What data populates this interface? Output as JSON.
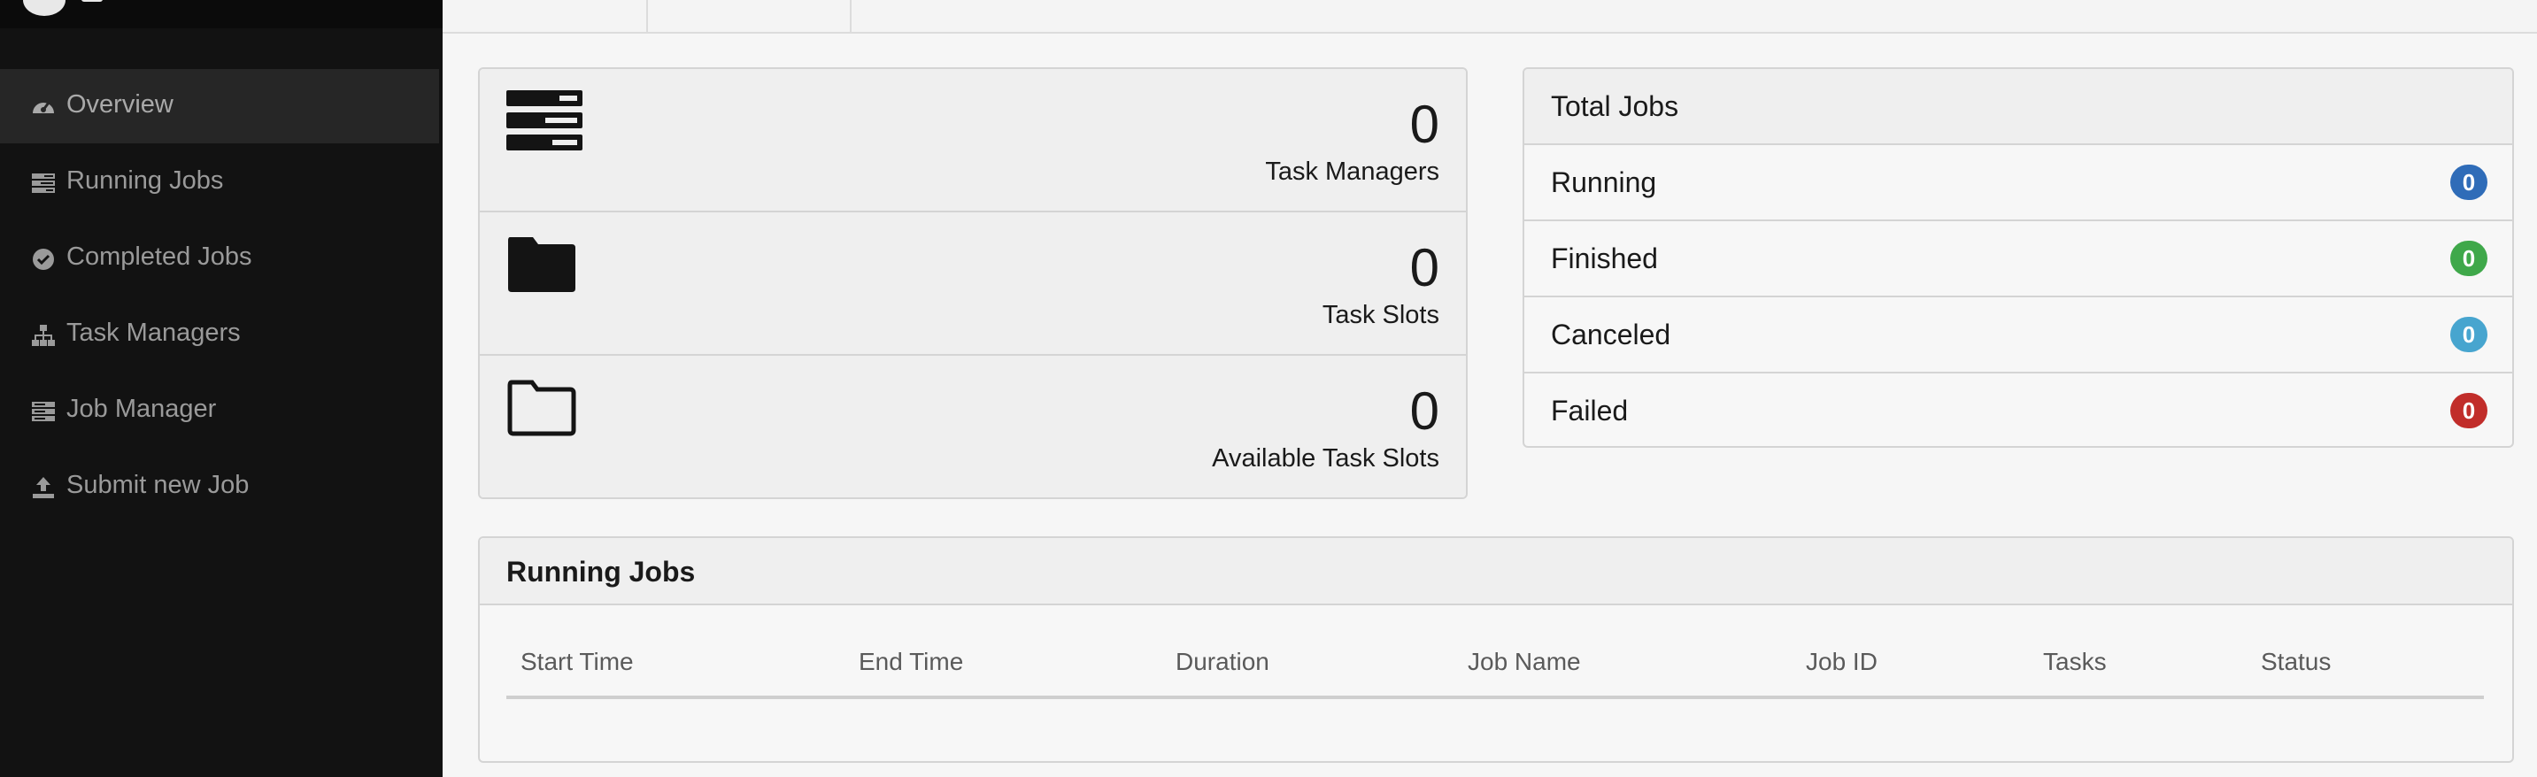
{
  "sidebar": {
    "items": [
      {
        "label": "Overview",
        "icon": "dashboard-icon",
        "active": true
      },
      {
        "label": "Running Jobs",
        "icon": "tasks-icon",
        "active": false
      },
      {
        "label": "Completed Jobs",
        "icon": "check-circle-icon",
        "active": false
      },
      {
        "label": "Task Managers",
        "icon": "sitemap-icon",
        "active": false
      },
      {
        "label": "Job Manager",
        "icon": "server-icon",
        "active": false
      },
      {
        "label": "Submit new Job",
        "icon": "upload-icon",
        "active": false
      }
    ]
  },
  "stats": {
    "task_managers": {
      "value": "0",
      "label": "Task Managers",
      "icon": "tasks-large-icon"
    },
    "task_slots": {
      "value": "0",
      "label": "Task Slots",
      "icon": "folder-filled-icon"
    },
    "available_task_slots": {
      "value": "0",
      "label": "Available Task Slots",
      "icon": "folder-outline-icon"
    }
  },
  "total_jobs": {
    "title": "Total Jobs",
    "rows": [
      {
        "label": "Running",
        "count": "0",
        "color": "#2f6cb8"
      },
      {
        "label": "Finished",
        "count": "0",
        "color": "#3fa84a"
      },
      {
        "label": "Canceled",
        "count": "0",
        "color": "#47a5cf"
      },
      {
        "label": "Failed",
        "count": "0",
        "color": "#c12d2a"
      }
    ]
  },
  "running_jobs": {
    "title": "Running Jobs",
    "columns": [
      "Start Time",
      "End Time",
      "Duration",
      "Job Name",
      "Job ID",
      "Tasks",
      "Status"
    ]
  }
}
